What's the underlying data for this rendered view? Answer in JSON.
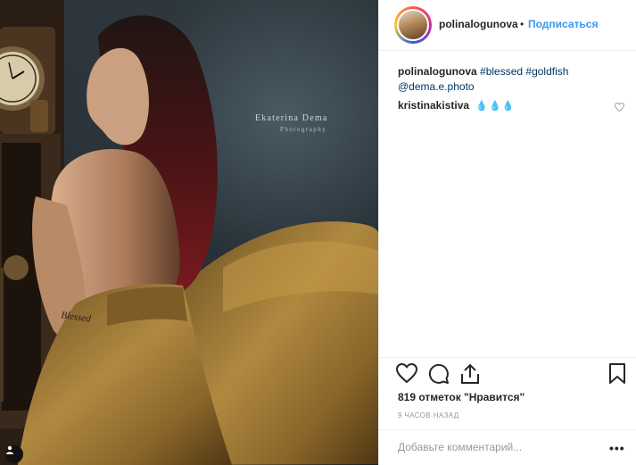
{
  "post": {
    "username": "polinalogunova",
    "dot": "•",
    "follow_label": "Подписаться",
    "photo": {
      "watermark_line1": "Ekaterina Dema",
      "watermark_line2": "Photography",
      "tattoo_text": "Blessed"
    },
    "caption": {
      "username": "polinalogunova",
      "tag1": "#blessed",
      "tag2": "#goldfish",
      "mention": "@dema.e.photo"
    },
    "comment": {
      "username": "kristinakistiva",
      "emoji": "💧💧💧"
    },
    "likes_text": "819 отметок \"Нравится\"",
    "time_text": "9 ЧАСОВ НАЗАД",
    "comment_placeholder": "Добавьте комментарий...",
    "more_label": "•••",
    "icons": {
      "like": "heart-icon",
      "comment": "comment-bubble-icon",
      "share": "share-icon",
      "save": "bookmark-icon",
      "comment_like": "heart-small-icon",
      "user_tag": "user-tag-icon"
    },
    "colors": {
      "link": "#3897f0",
      "tag": "#003569",
      "text": "#262626",
      "muted": "#999999",
      "dress": "#a07a3a",
      "background": "#2d373d"
    }
  }
}
